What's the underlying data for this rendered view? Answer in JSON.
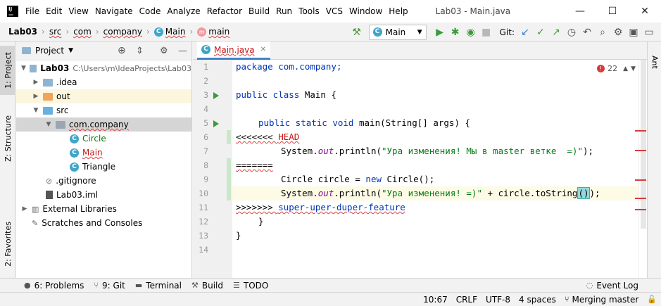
{
  "titlebar": {
    "menu": [
      "File",
      "Edit",
      "View",
      "Navigate",
      "Code",
      "Analyze",
      "Refactor",
      "Build",
      "Run",
      "Tools",
      "VCS",
      "Window",
      "Help"
    ],
    "window_title": "Lab03 - Main.java"
  },
  "navbar": {
    "crumbs": [
      "Lab03",
      "src",
      "com",
      "company",
      "Main",
      "main"
    ],
    "run_config": "Main",
    "git_label": "Git:"
  },
  "left_strip": {
    "project_tab": "1: Project",
    "structure_tab": "Z: Structure",
    "favorites_tab": "2: Favorites"
  },
  "project_panel": {
    "title": "Project",
    "tree": [
      {
        "label": "Lab03",
        "path": "C:\\Users\\m\\IdeaProjects\\Lab03"
      },
      {
        "label": ".idea"
      },
      {
        "label": "out"
      },
      {
        "label": "src"
      },
      {
        "label": "com.company"
      },
      {
        "label": "Circle"
      },
      {
        "label": "Main"
      },
      {
        "label": "Triangle"
      },
      {
        "label": ".gitignore"
      },
      {
        "label": "Lab03.iml"
      },
      {
        "label": "External Libraries"
      },
      {
        "label": "Scratches and Consoles"
      }
    ]
  },
  "editor": {
    "tab_label": "Main.java",
    "error_count": "22",
    "line_numbers": [
      "1",
      "2",
      "3",
      "4",
      "5",
      "6",
      "7",
      "8",
      "9",
      "10",
      "11",
      "12",
      "13",
      "14"
    ],
    "lines": {
      "l1": "package com.company;",
      "l3_kw": "public class",
      "l3_rest": " Main {",
      "l5_kw": "public static void",
      "l5_rest": " main(String[] args) {",
      "l6_marker": "<<<<<<< ",
      "l6_head": "HEAD",
      "l7_a": "System.",
      "l7_out": "out",
      "l7_b": ".println(",
      "l7_str": "\"Ура изменения! Мы в master ветке  =)\"",
      "l7_c": ");",
      "l8": "=======",
      "l9_a": "Circle circle = ",
      "l9_new": "new",
      "l9_b": " Circle();",
      "l10_a": "System.",
      "l10_out": "out",
      "l10_b": ".println(",
      "l10_str": "\"Ура изменения! =)\"",
      "l10_c": " + circle.toString",
      "l10_paren": "()",
      "l10_d": ");",
      "l11_marker": ">>>>>>> ",
      "l11_branch": "super-uper-duper-feature",
      "l12": "}",
      "l13": "}"
    }
  },
  "right_strip": {
    "ant_tab": "Ant"
  },
  "bottom_tools": {
    "problems": "6: Problems",
    "git": "9: Git",
    "terminal": "Terminal",
    "build": "Build",
    "todo": "TODO",
    "event_log": "Event Log"
  },
  "status": {
    "position": "10:67",
    "line_sep": "CRLF",
    "encoding": "UTF-8",
    "indent": "4 spaces",
    "branch": "Merging master"
  },
  "colors": {
    "keyword": "#0033b3",
    "string": "#067d17",
    "static_field": "#871094",
    "accent": "#4083c9"
  }
}
